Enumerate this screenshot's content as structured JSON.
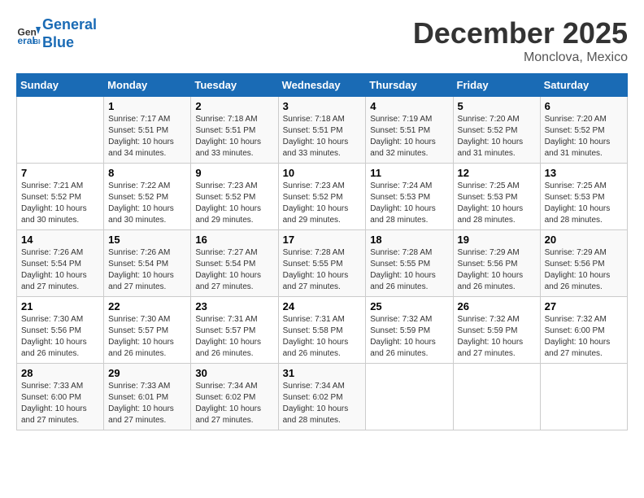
{
  "header": {
    "logo_line1": "General",
    "logo_line2": "Blue",
    "month": "December 2025",
    "location": "Monclova, Mexico"
  },
  "weekdays": [
    "Sunday",
    "Monday",
    "Tuesday",
    "Wednesday",
    "Thursday",
    "Friday",
    "Saturday"
  ],
  "weeks": [
    [
      {
        "day": "",
        "info": ""
      },
      {
        "day": "1",
        "info": "Sunrise: 7:17 AM\nSunset: 5:51 PM\nDaylight: 10 hours\nand 34 minutes."
      },
      {
        "day": "2",
        "info": "Sunrise: 7:18 AM\nSunset: 5:51 PM\nDaylight: 10 hours\nand 33 minutes."
      },
      {
        "day": "3",
        "info": "Sunrise: 7:18 AM\nSunset: 5:51 PM\nDaylight: 10 hours\nand 33 minutes."
      },
      {
        "day": "4",
        "info": "Sunrise: 7:19 AM\nSunset: 5:51 PM\nDaylight: 10 hours\nand 32 minutes."
      },
      {
        "day": "5",
        "info": "Sunrise: 7:20 AM\nSunset: 5:52 PM\nDaylight: 10 hours\nand 31 minutes."
      },
      {
        "day": "6",
        "info": "Sunrise: 7:20 AM\nSunset: 5:52 PM\nDaylight: 10 hours\nand 31 minutes."
      }
    ],
    [
      {
        "day": "7",
        "info": "Sunrise: 7:21 AM\nSunset: 5:52 PM\nDaylight: 10 hours\nand 30 minutes."
      },
      {
        "day": "8",
        "info": "Sunrise: 7:22 AM\nSunset: 5:52 PM\nDaylight: 10 hours\nand 30 minutes."
      },
      {
        "day": "9",
        "info": "Sunrise: 7:23 AM\nSunset: 5:52 PM\nDaylight: 10 hours\nand 29 minutes."
      },
      {
        "day": "10",
        "info": "Sunrise: 7:23 AM\nSunset: 5:52 PM\nDaylight: 10 hours\nand 29 minutes."
      },
      {
        "day": "11",
        "info": "Sunrise: 7:24 AM\nSunset: 5:53 PM\nDaylight: 10 hours\nand 28 minutes."
      },
      {
        "day": "12",
        "info": "Sunrise: 7:25 AM\nSunset: 5:53 PM\nDaylight: 10 hours\nand 28 minutes."
      },
      {
        "day": "13",
        "info": "Sunrise: 7:25 AM\nSunset: 5:53 PM\nDaylight: 10 hours\nand 28 minutes."
      }
    ],
    [
      {
        "day": "14",
        "info": "Sunrise: 7:26 AM\nSunset: 5:54 PM\nDaylight: 10 hours\nand 27 minutes."
      },
      {
        "day": "15",
        "info": "Sunrise: 7:26 AM\nSunset: 5:54 PM\nDaylight: 10 hours\nand 27 minutes."
      },
      {
        "day": "16",
        "info": "Sunrise: 7:27 AM\nSunset: 5:54 PM\nDaylight: 10 hours\nand 27 minutes."
      },
      {
        "day": "17",
        "info": "Sunrise: 7:28 AM\nSunset: 5:55 PM\nDaylight: 10 hours\nand 27 minutes."
      },
      {
        "day": "18",
        "info": "Sunrise: 7:28 AM\nSunset: 5:55 PM\nDaylight: 10 hours\nand 26 minutes."
      },
      {
        "day": "19",
        "info": "Sunrise: 7:29 AM\nSunset: 5:56 PM\nDaylight: 10 hours\nand 26 minutes."
      },
      {
        "day": "20",
        "info": "Sunrise: 7:29 AM\nSunset: 5:56 PM\nDaylight: 10 hours\nand 26 minutes."
      }
    ],
    [
      {
        "day": "21",
        "info": "Sunrise: 7:30 AM\nSunset: 5:56 PM\nDaylight: 10 hours\nand 26 minutes."
      },
      {
        "day": "22",
        "info": "Sunrise: 7:30 AM\nSunset: 5:57 PM\nDaylight: 10 hours\nand 26 minutes."
      },
      {
        "day": "23",
        "info": "Sunrise: 7:31 AM\nSunset: 5:57 PM\nDaylight: 10 hours\nand 26 minutes."
      },
      {
        "day": "24",
        "info": "Sunrise: 7:31 AM\nSunset: 5:58 PM\nDaylight: 10 hours\nand 26 minutes."
      },
      {
        "day": "25",
        "info": "Sunrise: 7:32 AM\nSunset: 5:59 PM\nDaylight: 10 hours\nand 26 minutes."
      },
      {
        "day": "26",
        "info": "Sunrise: 7:32 AM\nSunset: 5:59 PM\nDaylight: 10 hours\nand 27 minutes."
      },
      {
        "day": "27",
        "info": "Sunrise: 7:32 AM\nSunset: 6:00 PM\nDaylight: 10 hours\nand 27 minutes."
      }
    ],
    [
      {
        "day": "28",
        "info": "Sunrise: 7:33 AM\nSunset: 6:00 PM\nDaylight: 10 hours\nand 27 minutes."
      },
      {
        "day": "29",
        "info": "Sunrise: 7:33 AM\nSunset: 6:01 PM\nDaylight: 10 hours\nand 27 minutes."
      },
      {
        "day": "30",
        "info": "Sunrise: 7:34 AM\nSunset: 6:02 PM\nDaylight: 10 hours\nand 27 minutes."
      },
      {
        "day": "31",
        "info": "Sunrise: 7:34 AM\nSunset: 6:02 PM\nDaylight: 10 hours\nand 28 minutes."
      },
      {
        "day": "",
        "info": ""
      },
      {
        "day": "",
        "info": ""
      },
      {
        "day": "",
        "info": ""
      }
    ]
  ]
}
